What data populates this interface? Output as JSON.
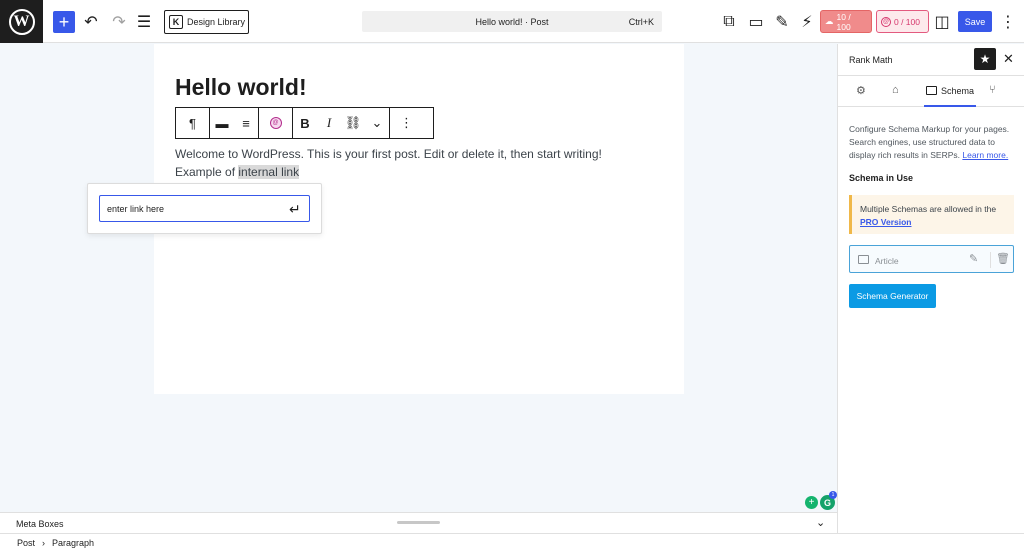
{
  "topbar": {
    "wp_logo": "W",
    "add_icon": "+",
    "undo_icon": "↶",
    "redo_icon": "↷",
    "list_view_icon": "☰",
    "design_library_icon": "K",
    "design_library_label": "Design Library",
    "document_title": "Hello world! · Post",
    "shortcut": "Ctrl+K",
    "external_icon": "⧉",
    "preview_icon": "▭",
    "edit_icon": "✎",
    "speed_icon": "⚡",
    "seo_score": "10 / 100",
    "ai_score": "0 / 100",
    "ai_badge": "@",
    "sidebar_toggle_icon": "◫",
    "save_label": "Save",
    "more_icon": "⋮"
  },
  "editor": {
    "post_title": "Hello world!",
    "toolbar": {
      "paragraph_icon": "¶",
      "align_wide_icon": "▬",
      "align_left_icon": "≡",
      "rank_math_icon": "@",
      "bold_icon": "B",
      "italic_icon": "I",
      "link_icon": "⛓",
      "more_rich_icon": "⌄",
      "options_icon": "⋮"
    },
    "paragraph_text": "Welcome to WordPress. This is your first post. Edit or delete it, then start writing! Example of ",
    "highlighted_text": "internal link",
    "link_popover": {
      "input_value": "enter link here",
      "submit_icon": "↵"
    }
  },
  "sidebar": {
    "title": "Rank Math",
    "star_icon": "★",
    "close_icon": "✕",
    "tabs": {
      "settings_icon": "⚙",
      "toolbox_icon": "⌂",
      "schema_label": "Schema",
      "social_icon": "⑂"
    },
    "description": "Configure Schema Markup for your pages. Search engines, use structured data to display rich results in SERPs. ",
    "learn_more": "Learn more.",
    "schema_in_use": "Schema in Use",
    "pro_notice_text": "Multiple Schemas are allowed in the ",
    "pro_version_link": "PRO Version",
    "schema_item_label": "Article",
    "schema_edit_icon": "✎",
    "schema_delete_icon": "🗑",
    "schema_generator_label": "Schema Generator"
  },
  "floating": {
    "plus_icon": "+",
    "g_icon": "G",
    "badge_count": "1"
  },
  "meta_boxes": {
    "label": "Meta Boxes",
    "chevron": "⌄"
  },
  "footer": {
    "crumb_post": "Post",
    "crumb_sep": "›",
    "crumb_paragraph": "Paragraph"
  }
}
